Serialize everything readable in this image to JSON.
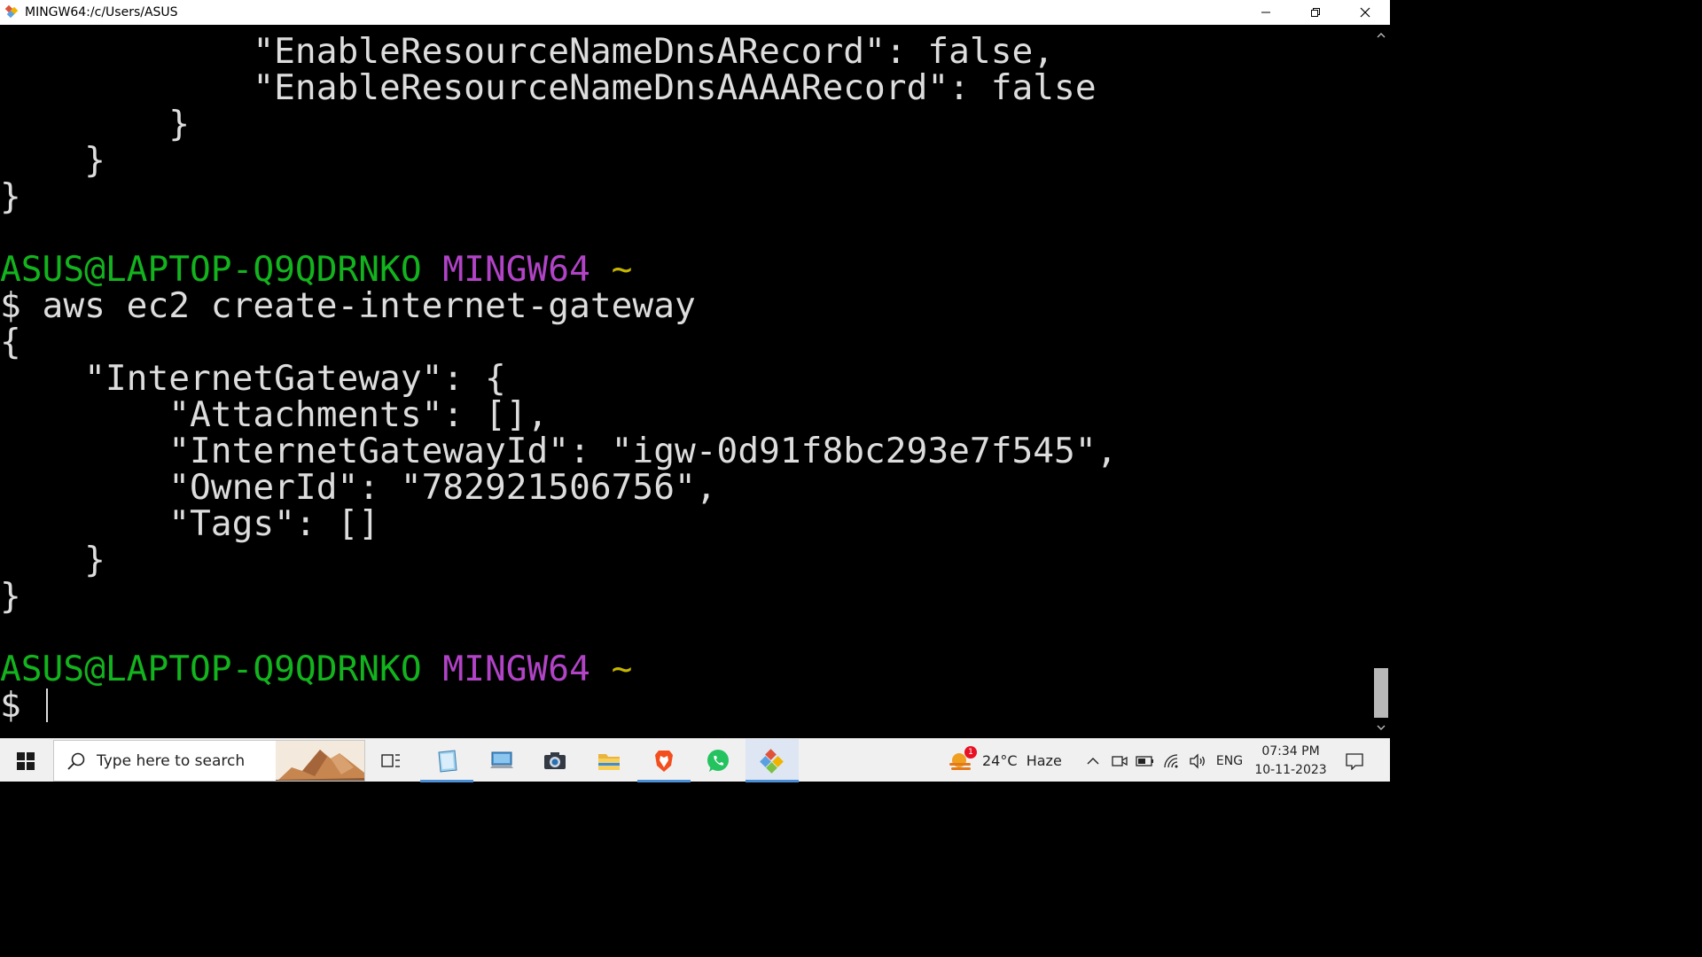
{
  "window": {
    "title": "MINGW64:/c/Users/ASUS"
  },
  "terminal": {
    "lines": [
      [
        {
          "t": "            \"EnableResourceNameDnsARecord\": false,",
          "c": ""
        }
      ],
      [
        {
          "t": "            \"EnableResourceNameDnsAAAARecord\": false",
          "c": ""
        }
      ],
      [
        {
          "t": "        }",
          "c": ""
        }
      ],
      [
        {
          "t": "    }",
          "c": ""
        }
      ],
      [
        {
          "t": "}",
          "c": ""
        }
      ],
      [
        {
          "t": "",
          "c": ""
        }
      ],
      [
        {
          "t": "ASUS@LAPTOP-Q9QDRNKO",
          "c": "green"
        },
        {
          "t": " ",
          "c": ""
        },
        {
          "t": "MINGW64",
          "c": "magenta"
        },
        {
          "t": " ",
          "c": ""
        },
        {
          "t": "~",
          "c": "yellow"
        }
      ],
      [
        {
          "t": "$ aws ec2 create-internet-gateway",
          "c": ""
        }
      ],
      [
        {
          "t": "{",
          "c": ""
        }
      ],
      [
        {
          "t": "    \"InternetGateway\": {",
          "c": ""
        }
      ],
      [
        {
          "t": "        \"Attachments\": [],",
          "c": ""
        }
      ],
      [
        {
          "t": "        \"InternetGatewayId\": \"igw-0d91f8bc293e7f545\",",
          "c": ""
        }
      ],
      [
        {
          "t": "        \"OwnerId\": \"782921506756\",",
          "c": ""
        }
      ],
      [
        {
          "t": "        \"Tags\": []",
          "c": ""
        }
      ],
      [
        {
          "t": "    }",
          "c": ""
        }
      ],
      [
        {
          "t": "}",
          "c": ""
        }
      ],
      [
        {
          "t": "",
          "c": ""
        }
      ],
      [
        {
          "t": "ASUS@LAPTOP-Q9QDRNKO",
          "c": "green"
        },
        {
          "t": " ",
          "c": ""
        },
        {
          "t": "MINGW64",
          "c": "magenta"
        },
        {
          "t": " ",
          "c": ""
        },
        {
          "t": "~",
          "c": "yellow"
        }
      ],
      [
        {
          "t": "$ ",
          "c": ""
        }
      ]
    ]
  },
  "taskbar": {
    "search_placeholder": "Type here to search",
    "weather_badge": "1",
    "weather_text": "24°C  Haze",
    "language": "ENG",
    "time": "07:34 PM",
    "date": "10-11-2023"
  },
  "colors": {
    "prompt_user": "#13b31e",
    "prompt_shell": "#b143c6",
    "prompt_path": "#c6b600",
    "terminal_text": "#dddddd",
    "terminal_bg": "#000000"
  }
}
